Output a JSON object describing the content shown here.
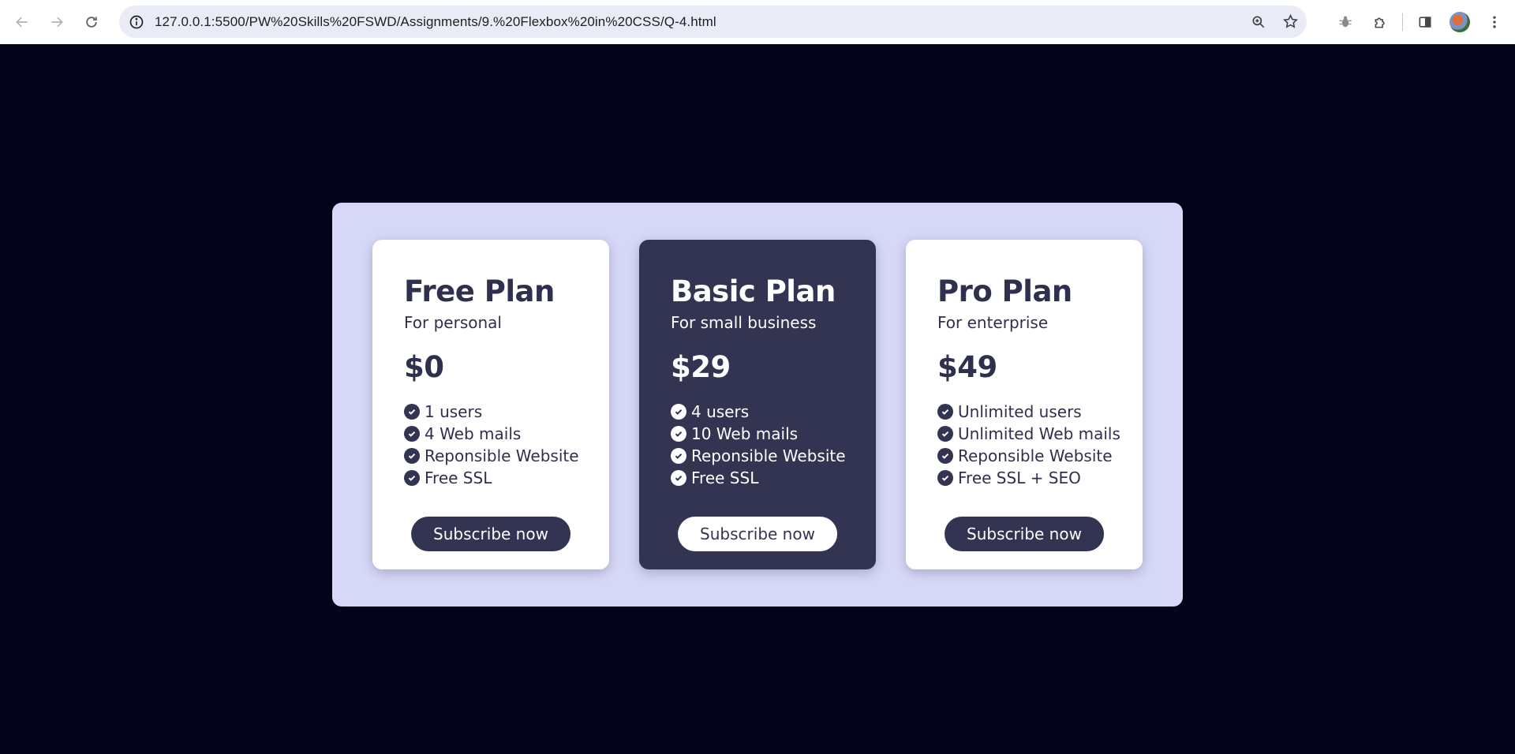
{
  "browser": {
    "url": "127.0.0.1:5500/PW%20Skills%20FSWD/Assignments/9.%20Flexbox%20in%20CSS/Q-4.html",
    "icons": [
      "back-arrow-icon",
      "forward-arrow-icon",
      "reload-icon",
      "site-info-icon",
      "zoom-icon",
      "star-icon",
      "bug-extension-icon",
      "extensions-puzzle-icon",
      "side-panel-icon",
      "profile-avatar",
      "menu-dots-icon"
    ]
  },
  "colors": {
    "page_background": "#03041a",
    "panel_background": "#d7d8f7",
    "accent_dark": "#333352",
    "card_light": "#ffffff"
  },
  "plans": [
    {
      "title": "Free Plan",
      "subtitle": "For personal",
      "price": "$0",
      "features": [
        "1 users",
        "4 Web mails",
        "Reponsible Website",
        "Free SSL"
      ],
      "button": "Subscribe now",
      "highlighted": false
    },
    {
      "title": "Basic Plan",
      "subtitle": "For small business",
      "price": "$29",
      "features": [
        "4 users",
        "10 Web mails",
        "Reponsible Website",
        "Free SSL"
      ],
      "button": "Subscribe now",
      "highlighted": true
    },
    {
      "title": "Pro Plan",
      "subtitle": "For enterprise",
      "price": "$49",
      "features": [
        "Unlimited users",
        "Unlimited Web mails",
        "Reponsible Website",
        "Free SSL + SEO"
      ],
      "button": "Subscribe now",
      "highlighted": false
    }
  ]
}
